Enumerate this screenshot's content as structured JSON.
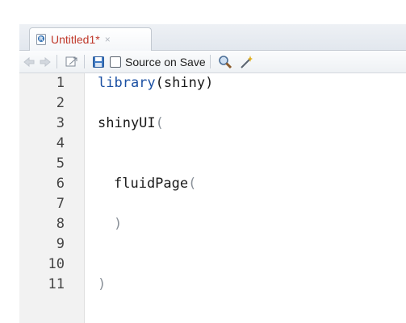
{
  "tab": {
    "label": "Untitled1*",
    "close": "×"
  },
  "toolbar": {
    "source_on_save_label": "Source on Save",
    "source_on_save_checked": false
  },
  "editor": {
    "line_numbers": [
      "1",
      "2",
      "3",
      "4",
      "5",
      "6",
      "7",
      "8",
      "9",
      "10",
      "11"
    ],
    "lines": [
      {
        "fn": "library",
        "arg": "shiny",
        "close": ")"
      },
      null,
      {
        "fn": "shinyUI",
        "paren": "("
      },
      null,
      null,
      {
        "fn": "fluidPage",
        "paren": "("
      },
      null,
      {
        "paren": ")"
      },
      null,
      null,
      {
        "paren": ")"
      }
    ],
    "l1_fn": "library",
    "l1_open": "(",
    "l1_arg": "shiny",
    "l1_close": ")",
    "l3_fn": "shinyUI",
    "l3_paren": "(",
    "l6_fn": "fluidPage",
    "l6_paren": "(",
    "l8_paren": ")",
    "l11_paren": ")"
  },
  "colors": {
    "keyword": "#1b50a3",
    "paren": "#8a9199",
    "tab_title": "#c0392b"
  }
}
